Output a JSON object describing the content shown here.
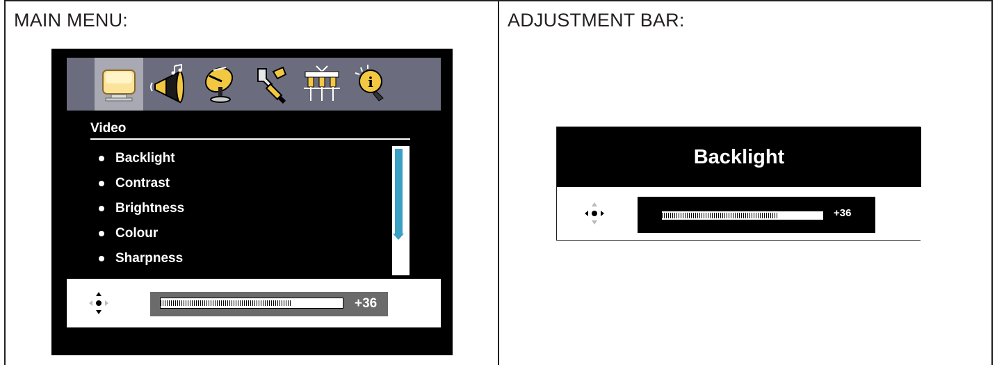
{
  "sections": {
    "main_menu_title": "MAIN MENU:",
    "adjustment_bar_title": "ADJUSTMENT BAR:"
  },
  "osd": {
    "icons": [
      {
        "name": "picture-icon",
        "selected": true
      },
      {
        "name": "sound-icon",
        "selected": false
      },
      {
        "name": "tv-antenna-icon",
        "selected": false
      },
      {
        "name": "setup-icon",
        "selected": false
      },
      {
        "name": "connection-icon",
        "selected": false
      },
      {
        "name": "info-icon",
        "selected": false
      }
    ],
    "heading": "Video",
    "items": [
      {
        "label": "Backlight"
      },
      {
        "label": "Contrast"
      },
      {
        "label": "Brightness"
      },
      {
        "label": "Colour"
      },
      {
        "label": "Sharpness"
      }
    ],
    "slider_value": "+36",
    "slider_fraction": 0.72
  },
  "adjustment": {
    "title": "Backlight",
    "slider_value": "+36",
    "slider_fraction": 0.72
  },
  "colors": {
    "icon_bar": "#6b6d7e",
    "scroll_accent": "#3aa0c4",
    "osd_bg": "#000000"
  }
}
